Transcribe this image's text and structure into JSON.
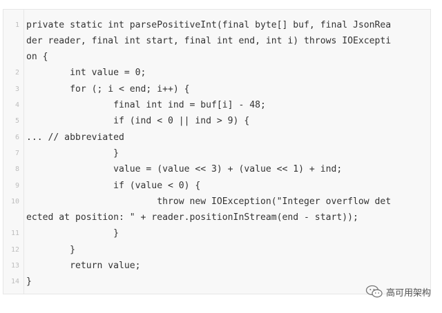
{
  "code": {
    "lines": [
      {
        "num": "1",
        "text": "private static int parsePositiveInt(final byte[] buf, final JsonRea"
      },
      {
        "num": "",
        "text": "der reader, final int start, final int end, int i) throws IOExcepti"
      },
      {
        "num": "",
        "text": "on {"
      },
      {
        "num": "2",
        "text": "        int value = 0;"
      },
      {
        "num": "3",
        "text": "        for (; i < end; i++) {"
      },
      {
        "num": "4",
        "text": "                final int ind = buf[i] - 48;"
      },
      {
        "num": "5",
        "text": "                if (ind < 0 || ind > 9) {"
      },
      {
        "num": "6",
        "text": "... // abbreviated"
      },
      {
        "num": "7",
        "text": "                }"
      },
      {
        "num": "8",
        "text": "                value = (value << 3) + (value << 1) + ind;"
      },
      {
        "num": "9",
        "text": "                if (value < 0) {"
      },
      {
        "num": "10",
        "text": "                        throw new IOException(\"Integer overflow det"
      },
      {
        "num": "",
        "text": "ected at position: \" + reader.positionInStream(end - start));"
      },
      {
        "num": "11",
        "text": "                }"
      },
      {
        "num": "12",
        "text": "        }"
      },
      {
        "num": "13",
        "text": "        return value;"
      },
      {
        "num": "14",
        "text": "}"
      }
    ]
  },
  "watermark": {
    "text": "高可用架构",
    "icon": "wechat-icon"
  }
}
